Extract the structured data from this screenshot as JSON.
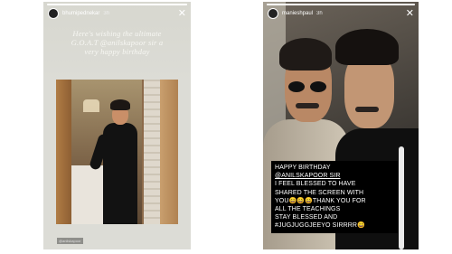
{
  "stories": [
    {
      "username": "bhumipednekar",
      "time": "3h",
      "progress": 1.0,
      "caption": [
        "Here's wishing the ultimate",
        "G.O.A.T @anilskapoor sir a",
        "very happy birthday"
      ],
      "photo_tag": "@anilskapoor"
    },
    {
      "username": "manieshpaul",
      "time": "3h",
      "progress": 1.0,
      "message_lines": [
        "HAPPY BIRTHDAY",
        "@ANILSKAPOOR  SIR",
        "I FEEL BLESSED TO HAVE",
        "SHARED THE SCREEN WITH",
        "YOU😄😄😄THANK YOU FOR",
        "ALL THE TEACHINGS",
        "STAY BLESSED AND",
        "#JUGJUGGJEEYO SIRRRR😄"
      ]
    }
  ],
  "icons": {
    "close": "close-icon",
    "avatar": "avatar"
  }
}
